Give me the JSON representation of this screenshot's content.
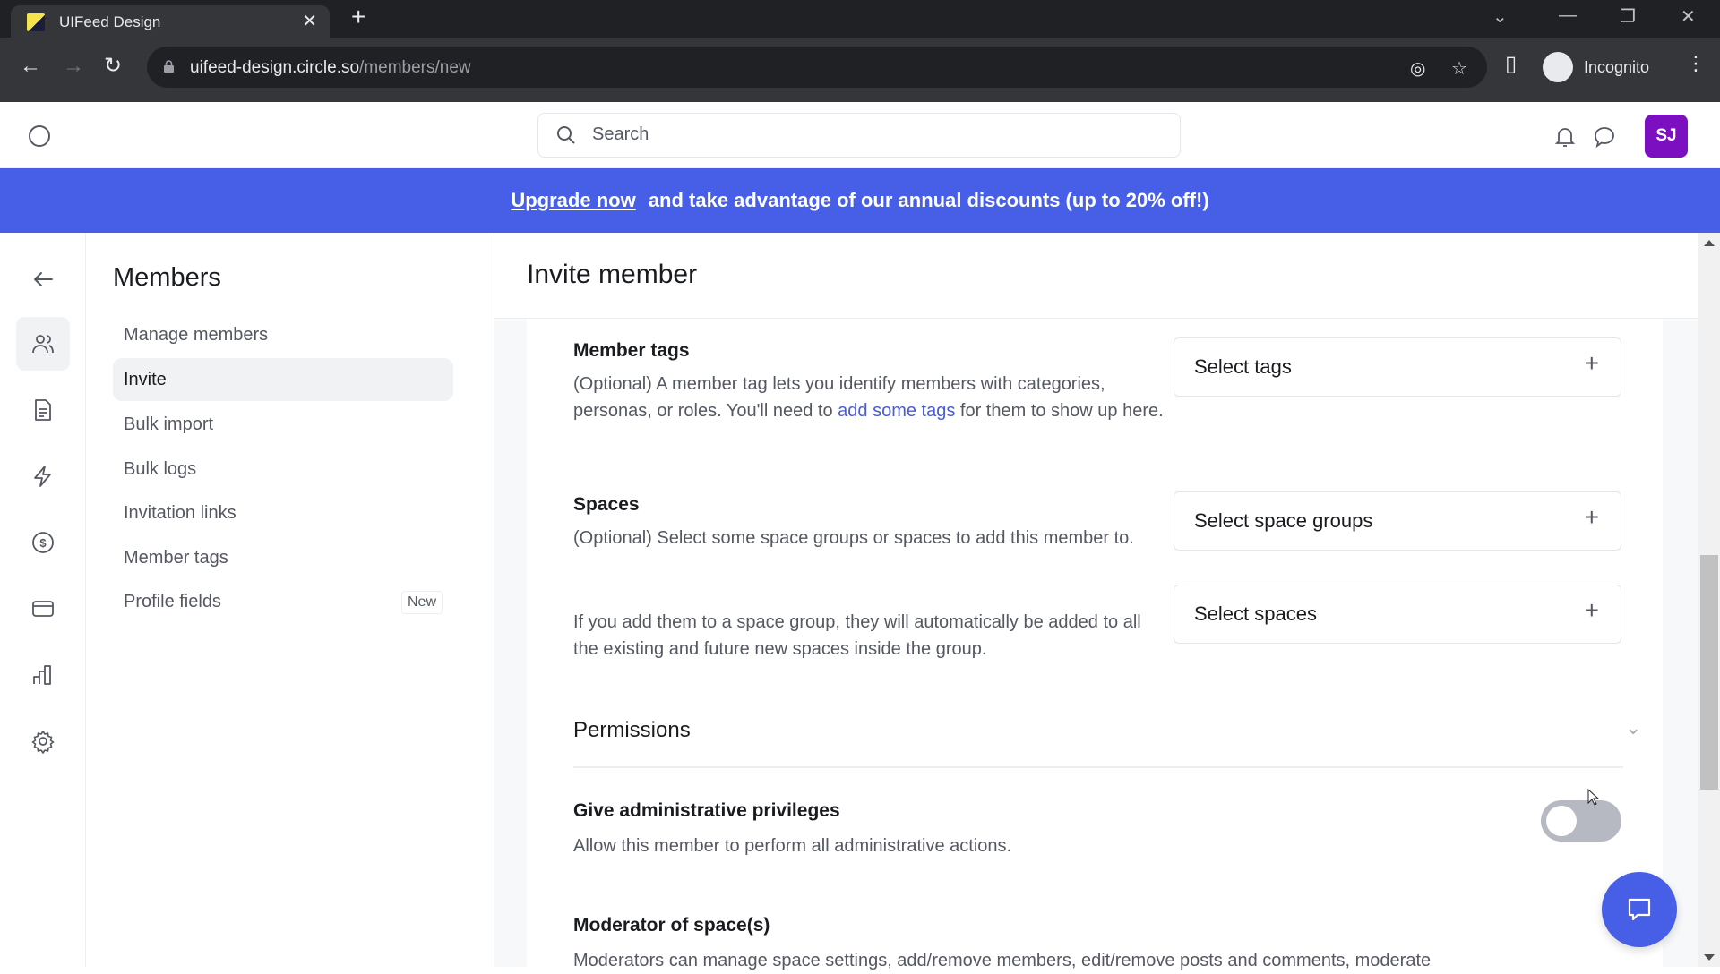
{
  "browser": {
    "tab_title": "UIFeed Design",
    "url_host": "uifeed-design.circle.so",
    "url_path": "/members/new",
    "profile_label": "Incognito"
  },
  "header": {
    "search_placeholder": "Search",
    "avatar_initials": "SJ"
  },
  "banner": {
    "link": "Upgrade now",
    "text": "and take advantage of our annual discounts (up to 20% off!)"
  },
  "rail": {
    "items": [
      {
        "icon": "back-arrow-icon"
      },
      {
        "icon": "members-icon",
        "active": true
      },
      {
        "icon": "document-icon"
      },
      {
        "icon": "lightning-icon"
      },
      {
        "icon": "dollar-icon"
      },
      {
        "icon": "credit-card-icon"
      },
      {
        "icon": "analytics-icon"
      },
      {
        "icon": "gear-icon"
      }
    ]
  },
  "subnav": {
    "title": "Members",
    "items": [
      {
        "label": "Manage members"
      },
      {
        "label": "Invite",
        "active": true
      },
      {
        "label": "Bulk import"
      },
      {
        "label": "Bulk logs"
      },
      {
        "label": "Invitation links"
      },
      {
        "label": "Member tags"
      },
      {
        "label": "Profile fields",
        "badge": "New"
      }
    ]
  },
  "main": {
    "title": "Invite member",
    "member_tags": {
      "label": "Member tags",
      "desc_before": "(Optional) A member tag lets you identify members with categories, personas, or roles. You'll need to ",
      "desc_link": "add some tags",
      "desc_after": " for them to show up here.",
      "select_label": "Select tags"
    },
    "spaces": {
      "label": "Spaces",
      "desc1": "(Optional) Select some space groups or spaces to add this member to.",
      "desc2": "If you add them to a space group, they will automatically be added to all the existing and future new spaces inside the group.",
      "select_groups_label": "Select space groups",
      "select_spaces_label": "Select spaces"
    },
    "permissions": {
      "title": "Permissions",
      "admin_label": "Give administrative privileges",
      "admin_desc": "Allow this member to perform all administrative actions.",
      "admin_enabled": false,
      "moderator_label": "Moderator of space(s)",
      "moderator_desc": "Moderators can manage space settings, add/remove members, edit/remove posts and comments, moderate"
    }
  },
  "colors": {
    "accent": "#475ee6",
    "avatar": "#7c0fbf",
    "link": "#4a5bd4",
    "toggle_off": "#b6b9c2"
  }
}
